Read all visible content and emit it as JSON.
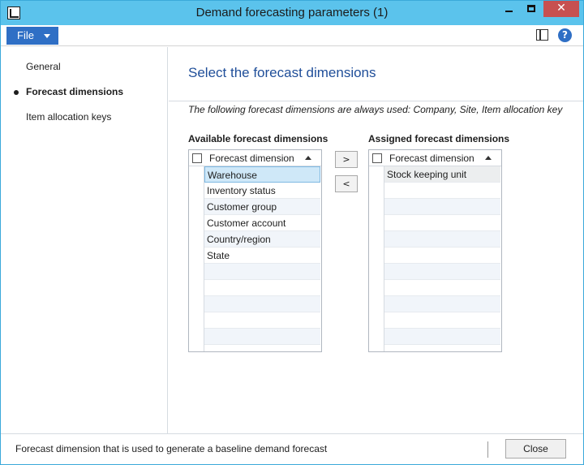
{
  "window": {
    "title": "Demand forecasting parameters (1)",
    "close_glyph": "✕",
    "accent_color": "#5bc3ec"
  },
  "menubar": {
    "file_label": "File",
    "icons": [
      "layout-icon",
      "help-icon"
    ],
    "help_glyph": "?"
  },
  "sidebar": {
    "items": [
      {
        "label": "General",
        "active": false
      },
      {
        "label": "Forecast dimensions",
        "active": true
      },
      {
        "label": "Item allocation keys",
        "active": false
      }
    ]
  },
  "main": {
    "title": "Select the forecast dimensions",
    "info": "The following forecast dimensions are always used: Company, Site, Item allocation key",
    "available": {
      "label": "Available forecast dimensions",
      "column_header": "Forecast dimension",
      "rows": [
        "Warehouse",
        "Inventory status",
        "Customer group",
        "Customer account",
        "Country/region",
        "State"
      ],
      "selected_row": "Warehouse"
    },
    "assigned": {
      "label": "Assigned forecast dimensions",
      "column_header": "Forecast dimension",
      "rows": [
        "Stock keeping unit"
      ]
    },
    "add_button": ">",
    "remove_button": "<"
  },
  "statusbar": {
    "text": "Forecast dimension that is used to generate a baseline demand forecast",
    "close_label": "Close"
  }
}
